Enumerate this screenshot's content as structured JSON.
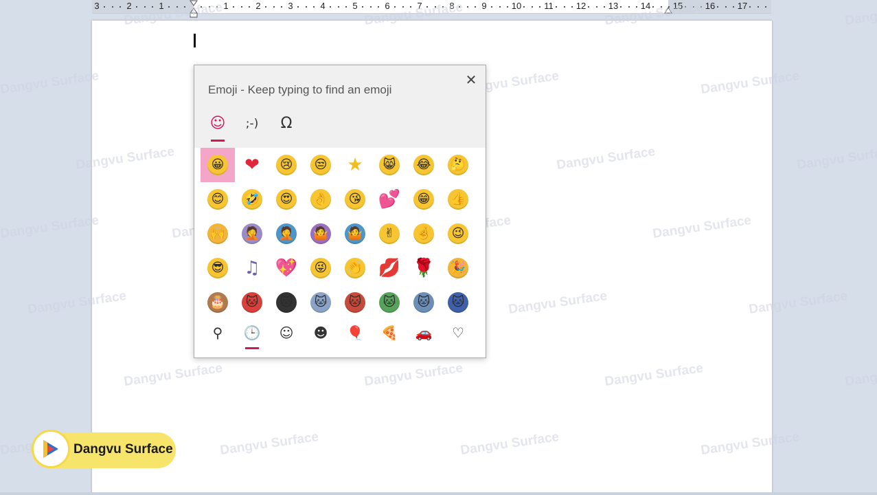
{
  "ruler": {
    "numbers": [
      "3",
      "2",
      "1",
      "1",
      "2",
      "3",
      "4",
      "5",
      "6",
      "7",
      "8",
      "9",
      "10",
      "11",
      "12",
      "13",
      "14",
      "15",
      "16",
      "17"
    ]
  },
  "watermark": {
    "text": "Dangvu Surface"
  },
  "panel": {
    "title": "Emoji - Keep typing to find an emoji",
    "close_label": "✕",
    "category_tabs": [
      {
        "name": "tab-emoji",
        "label": "☺"
      },
      {
        "name": "tab-kaomoji",
        "label": ";-)"
      },
      {
        "name": "tab-symbols",
        "label": "Ω"
      }
    ],
    "emoji_rows": [
      [
        {
          "name": "grinning-face",
          "glyph": "😀",
          "color": "#f6c531"
        },
        {
          "name": "red-heart",
          "glyph": "❤",
          "color": "#e0263b"
        },
        {
          "name": "crying-face",
          "glyph": "😢",
          "color": "#f6c531"
        },
        {
          "name": "unamused-face",
          "glyph": "😒",
          "color": "#f6c531"
        },
        {
          "name": "star",
          "glyph": "★",
          "color": "#f3bd1f"
        },
        {
          "name": "grinning-cat",
          "glyph": "😸",
          "color": "#f6c531"
        },
        {
          "name": "tears-of-joy",
          "glyph": "😂",
          "color": "#f6c531"
        },
        {
          "name": "thinking-face",
          "glyph": "🤔",
          "color": "#f6c531"
        }
      ],
      [
        {
          "name": "smiling-face",
          "glyph": "😊",
          "color": "#f6c531"
        },
        {
          "name": "rolling-laughing",
          "glyph": "🤣",
          "color": "#f6c531"
        },
        {
          "name": "heart-eyes",
          "glyph": "😍",
          "color": "#f6c531"
        },
        {
          "name": "ok-hand",
          "glyph": "👌",
          "color": "#f6c531"
        },
        {
          "name": "kissing-face",
          "glyph": "😘",
          "color": "#f6c531"
        },
        {
          "name": "two-hearts",
          "glyph": "💕",
          "color": "#e0263b"
        },
        {
          "name": "grimacing-face",
          "glyph": "😁",
          "color": "#f6c531"
        },
        {
          "name": "thumbs-up",
          "glyph": "👍",
          "color": "#f6c531"
        }
      ],
      [
        {
          "name": "raising-hands",
          "glyph": "🙌",
          "color": "#f2b53a"
        },
        {
          "name": "facepalm",
          "glyph": "🤦",
          "color": "#9b8cc7"
        },
        {
          "name": "facepalm-man",
          "glyph": "🤦",
          "color": "#4c96c9"
        },
        {
          "name": "shrug-woman",
          "glyph": "🤷",
          "color": "#9b6fc0"
        },
        {
          "name": "shrug-man",
          "glyph": "🤷",
          "color": "#4c96c9"
        },
        {
          "name": "victory-hand",
          "glyph": "✌",
          "color": "#f6c531"
        },
        {
          "name": "crossed-fingers",
          "glyph": "🤞",
          "color": "#f6c531"
        },
        {
          "name": "winking-face",
          "glyph": "😉",
          "color": "#f6c531"
        }
      ],
      [
        {
          "name": "sunglasses-face",
          "glyph": "😎",
          "color": "#f6c531"
        },
        {
          "name": "musical-notes",
          "glyph": "♫",
          "color": "#6d63b5"
        },
        {
          "name": "sparkling-heart",
          "glyph": "💖",
          "color": "#e0263b"
        },
        {
          "name": "tongue-wink",
          "glyph": "😜",
          "color": "#f6c531"
        },
        {
          "name": "clapping-hands",
          "glyph": "👏",
          "color": "#f6c531"
        },
        {
          "name": "kiss-lips",
          "glyph": "💋",
          "color": "#d81e2c"
        },
        {
          "name": "rose",
          "glyph": "🌹",
          "color": "#c9202b"
        },
        {
          "name": "party-popper",
          "glyph": "🎉",
          "color": "#f2b53a"
        }
      ],
      [
        {
          "name": "birthday-cake",
          "glyph": "🎂",
          "color": "#b07a4c"
        },
        {
          "name": "ninja-cat-selfie",
          "glyph": "🐱",
          "color": "#d8413c"
        },
        {
          "name": "ninja-cat",
          "glyph": "🐱",
          "color": "#333333"
        },
        {
          "name": "astro-cat",
          "glyph": "🐱",
          "color": "#8aa3c7"
        },
        {
          "name": "hacker-cat",
          "glyph": "🐱",
          "color": "#c74b3c"
        },
        {
          "name": "dino-cat",
          "glyph": "🐱",
          "color": "#57a35c"
        },
        {
          "name": "stunt-cat",
          "glyph": "🐱",
          "color": "#6c8fb8"
        },
        {
          "name": "hipster-cat",
          "glyph": "🐱",
          "color": "#4060a8"
        }
      ]
    ],
    "bottom_tabs": [
      {
        "name": "search-tab",
        "label": "⚲"
      },
      {
        "name": "recent-tab",
        "label": "🕒"
      },
      {
        "name": "smileys-tab",
        "label": "☺"
      },
      {
        "name": "people-tab",
        "label": "☻"
      },
      {
        "name": "celebration-tab",
        "label": "🎈"
      },
      {
        "name": "food-tab",
        "label": "🍕"
      },
      {
        "name": "travel-tab",
        "label": "🚗"
      },
      {
        "name": "symbols-tab",
        "label": "♡"
      }
    ]
  },
  "brand": {
    "name": "Dangvu Surface",
    "colors": {
      "badge": "#f7e46a",
      "logo_blue": "#2b6fd6",
      "logo_red": "#e8483b",
      "logo_yellow": "#f5c133"
    }
  },
  "accent_color": "#d4145a",
  "selected_color": "#f4a6c8"
}
